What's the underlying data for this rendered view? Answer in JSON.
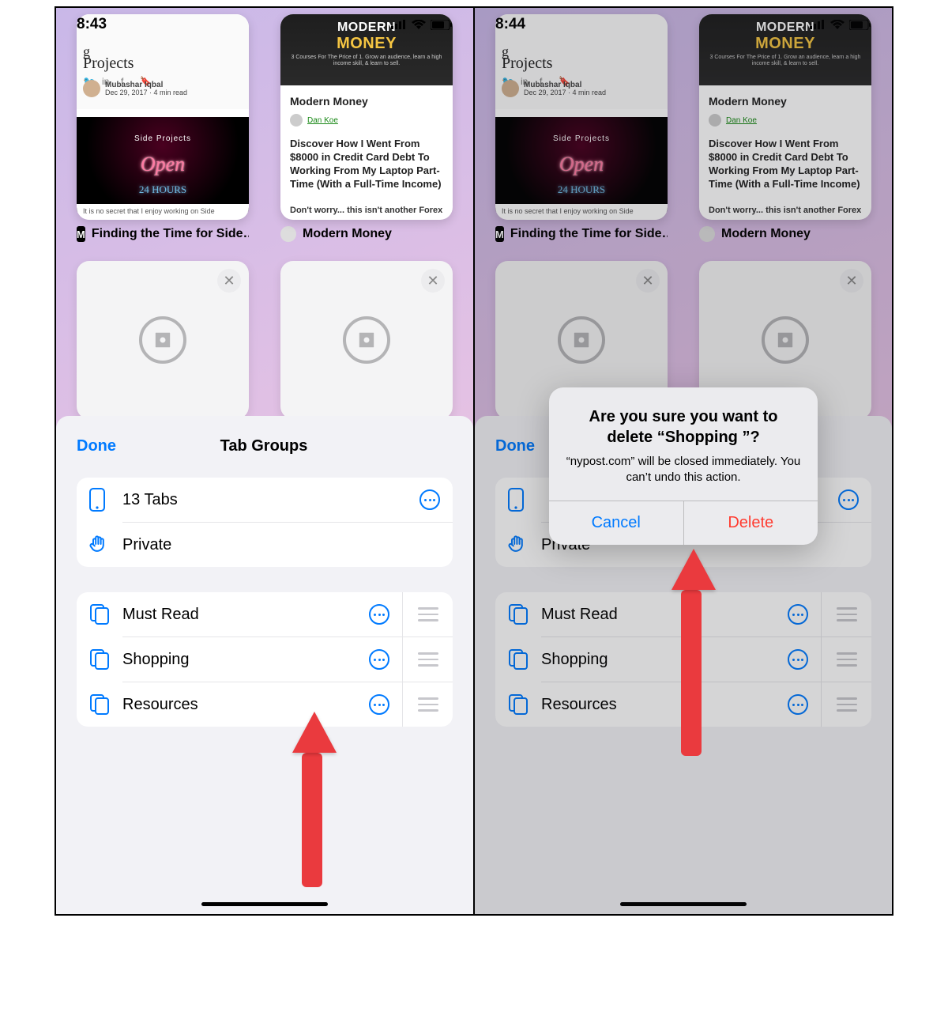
{
  "left": {
    "time": "8:43"
  },
  "right": {
    "time": "8:44"
  },
  "tabcaps": {
    "t1": "Finding the Time for Side…",
    "t2": "Modern Money"
  },
  "thumbs": {
    "sideprojects": {
      "subtitle": "Projects",
      "author": "Mubashar Iqbal",
      "meta": "Dec 29, 2017 · 4 min read",
      "neon_label": "Side Projects",
      "neon_main": "Open",
      "neon_hours": "24 HOURS",
      "footer": "It is no secret that I enjoy working on Side"
    },
    "money": {
      "word1": "MODERN",
      "word2": "MONEY",
      "sub": "3 Courses For The Price of 1.\nGrow an audience, learn a high income skill, & learn to sell.",
      "title": "Modern Money",
      "byline": "Dan Koe",
      "headline": "Discover How I Went From $8000 in Credit Card Debt To Working From My Laptop Part-Time (With a Full-Time Income)",
      "footer": "Don't worry... this isn't another Forex"
    }
  },
  "sheet": {
    "done": "Done",
    "title": "Tab Groups",
    "count": "13 Tabs",
    "private": "Private",
    "groups": [
      "Must Read",
      "Shopping",
      "Resources"
    ]
  },
  "alert": {
    "title": "Are you sure you want to delete “Shopping ”?",
    "message": "“nypost.com” will be closed immediately. You can’t undo this action.",
    "cancel": "Cancel",
    "delete": "Delete"
  }
}
